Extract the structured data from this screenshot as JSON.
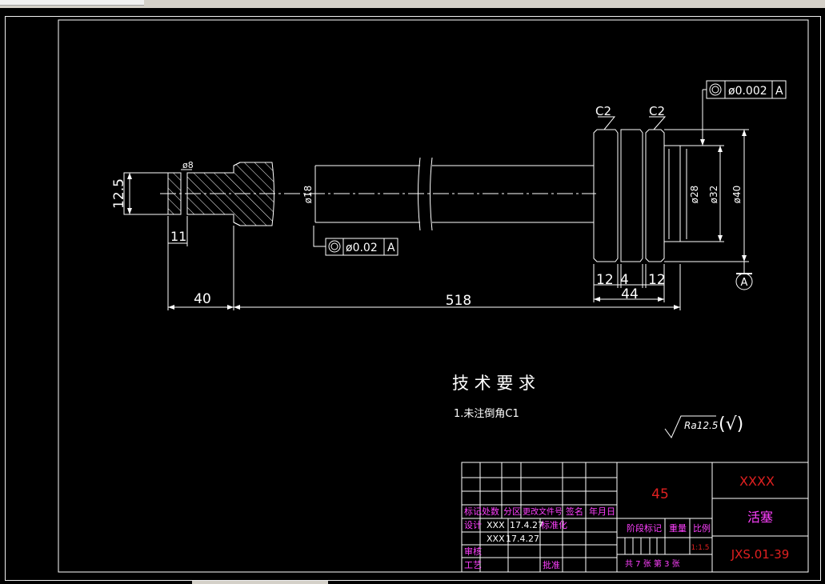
{
  "colors": {
    "line": "#ffffff",
    "title_red": "#e02020",
    "title_magenta": "#ff40ff",
    "dim_cyan": "#20c0e0"
  },
  "dimensions": {
    "d_12_5": "12.5",
    "d_phi8": "ø8",
    "d_11": "11",
    "d_phi18": "ø18",
    "d_40": "40",
    "d_518": "518",
    "d_12a": "12",
    "d_4": "4",
    "d_12b": "12",
    "d_44": "44",
    "d_phi28": "ø28",
    "d_phi32": "ø32",
    "d_phi40": "ø40",
    "chamfer_left": "C2",
    "chamfer_right": "C2"
  },
  "tolerances": {
    "top": {
      "value": "ø0.002",
      "datum": "A"
    },
    "mid": {
      "value": "ø0.02",
      "datum": "A"
    },
    "datum_marker": "A"
  },
  "notes": {
    "title": "技 术 要 求",
    "item1": "1.未注倒角C1",
    "roughness_value": "Ra12.5",
    "roughness_bracket": "(√)"
  },
  "title_block": {
    "material": "45",
    "company": "XXXX",
    "part_name": "活塞",
    "drawing_number": "JXS.01-39",
    "scale": "1:1.5",
    "headers": {
      "mark": "标记",
      "count": "处数",
      "zone": "分区",
      "doc_no": "更改文件号",
      "sign": "签名",
      "date": "年月日",
      "design": "设计",
      "standard": "标准化",
      "stage_mark": "阶段标记",
      "weight": "重量",
      "ratio": "比例",
      "review": "审核",
      "process": "工艺",
      "approve": "批准",
      "sheets": "共 7 张  第 3 张"
    },
    "signers": [
      {
        "name": "XXX",
        "date": "17.4.27"
      },
      {
        "name": "XXX",
        "date": "17.4.27"
      }
    ]
  }
}
